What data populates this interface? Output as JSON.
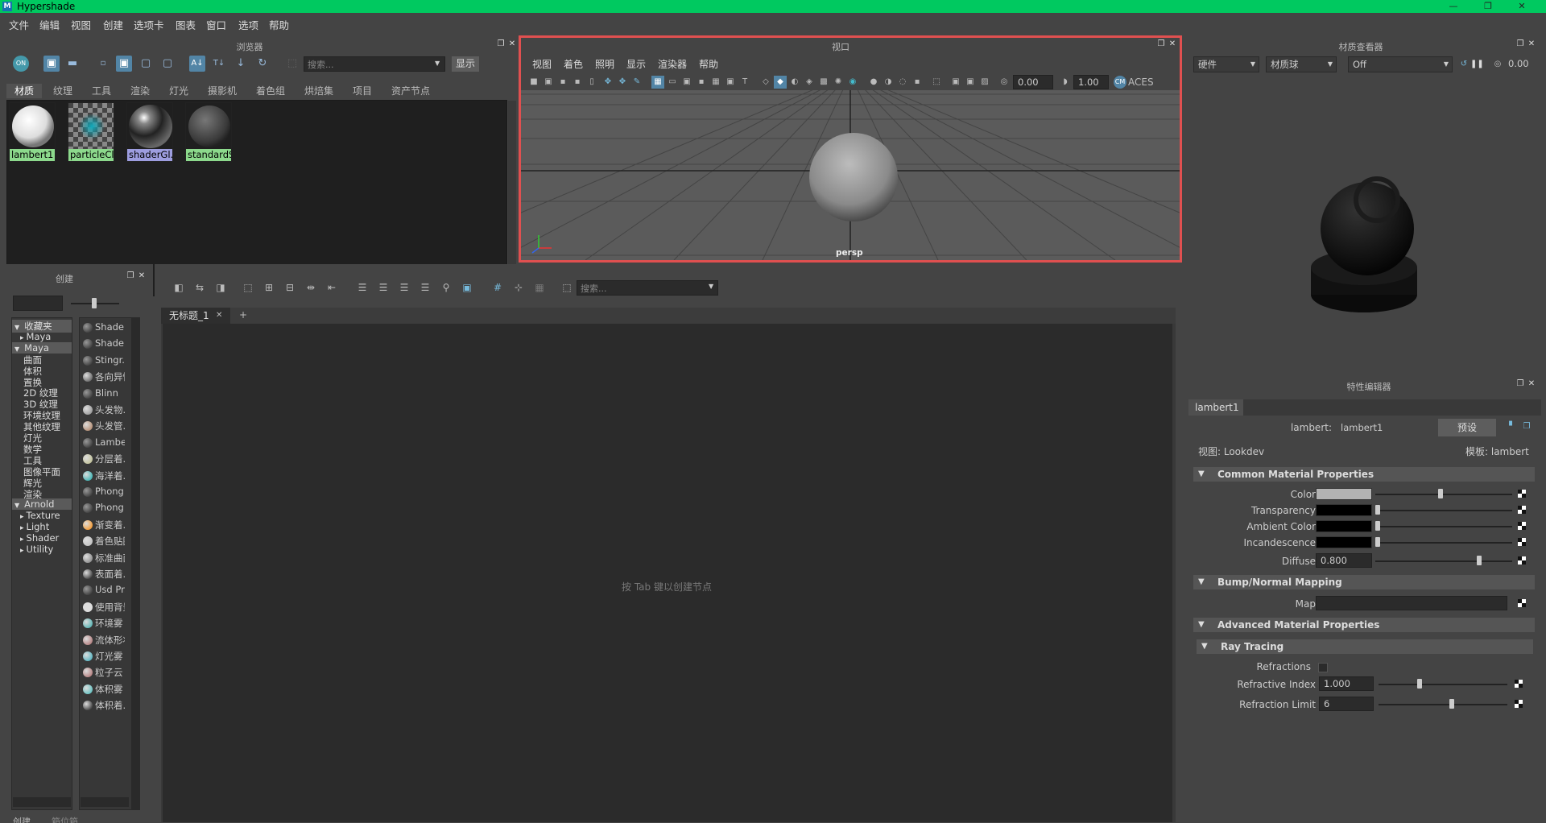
{
  "window": {
    "title": "Hypershade",
    "minimize": "—",
    "restore": "❐",
    "close": "✕"
  },
  "menus": [
    "文件",
    "编辑",
    "视图",
    "创建",
    "选项卡",
    "图表",
    "窗口",
    "选项",
    "帮助"
  ],
  "browser": {
    "title": "浏览器",
    "search_placeholder": "搜索...",
    "show_button": "显示",
    "tabs": [
      "材质",
      "纹理",
      "工具",
      "渲染",
      "灯光",
      "摄影机",
      "着色组",
      "烘焙集",
      "项目",
      "资产节点"
    ],
    "swatches": [
      {
        "label": "lambert1",
        "style": "lambert"
      },
      {
        "label": "particleCl...",
        "style": "particle"
      },
      {
        "label": "shaderGl...",
        "style": "shaderglow",
        "selected": true
      },
      {
        "label": "standardS...",
        "style": "standard"
      }
    ]
  },
  "viewport": {
    "title": "视口",
    "menus": [
      "视图",
      "着色",
      "照明",
      "显示",
      "渲染器",
      "帮助"
    ],
    "field_a": "0.00",
    "field_b": "1.00",
    "colorspace": "ACES",
    "camera_label": "persp"
  },
  "material_viewer": {
    "title": "材质查看器",
    "renderer": "硬件",
    "shape": "材质球",
    "mode": "Off",
    "value": "0.00"
  },
  "create": {
    "title": "创建",
    "tree": [
      {
        "label": "收藏夹",
        "kind": "header-open"
      },
      {
        "label": "Maya",
        "kind": "child-collapsed"
      },
      {
        "label": "Maya",
        "kind": "header-open"
      },
      {
        "label": "曲面",
        "kind": "leaf"
      },
      {
        "label": "体积",
        "kind": "leaf"
      },
      {
        "label": "置换",
        "kind": "leaf"
      },
      {
        "label": "2D 纹理",
        "kind": "leaf"
      },
      {
        "label": "3D 纹理",
        "kind": "leaf"
      },
      {
        "label": "环境纹理",
        "kind": "leaf"
      },
      {
        "label": "其他纹理",
        "kind": "leaf"
      },
      {
        "label": "灯光",
        "kind": "leaf"
      },
      {
        "label": "数学",
        "kind": "leaf"
      },
      {
        "label": "工具",
        "kind": "leaf"
      },
      {
        "label": "图像平面",
        "kind": "leaf"
      },
      {
        "label": "辉光",
        "kind": "leaf"
      },
      {
        "label": "渲染",
        "kind": "leaf"
      },
      {
        "label": "Arnold",
        "kind": "header-open"
      },
      {
        "label": "Texture",
        "kind": "child-collapsed"
      },
      {
        "label": "Light",
        "kind": "child-collapsed"
      },
      {
        "label": "Shader",
        "kind": "child-collapsed"
      },
      {
        "label": "Utility",
        "kind": "child-collapsed"
      }
    ],
    "nodes": [
      "Shade...",
      "Shade...",
      "Stingr...",
      "各向异性",
      "Blinn",
      "头发物...",
      "头发管...",
      "Lambe...",
      "分层着...",
      "海洋着...",
      "Phong",
      "Phong",
      "渐变着...",
      "着色贴图",
      "标准曲面",
      "表面着...",
      "Usd Pr...",
      "使用背景",
      "环境雾",
      "流体形状",
      "灯光雾",
      "粒子云",
      "体积雾",
      "体积着..."
    ],
    "bottom_tabs": [
      "创建",
      "箱位箱"
    ]
  },
  "graph": {
    "tab_label": "无标题_1",
    "tab_close": "✕",
    "add_tab": "+",
    "search_placeholder": "搜索...",
    "hint": "按 Tab 键以创建节点"
  },
  "attr_editor": {
    "title": "特性编辑器",
    "node_tab": "lambert1",
    "type_label": "lambert:",
    "node_name": "lambert1",
    "preset_button": "预设",
    "view_label": "视图: Lookdev",
    "template_label": "模板: lambert",
    "sections": {
      "common": "Common Material Properties",
      "bump": "Bump/Normal Mapping",
      "advanced": "Advanced Material Properties",
      "raytracing": "Ray Tracing"
    },
    "color_label": "Color",
    "transparency_label": "Transparency",
    "ambient_label": "Ambient Color",
    "incandescence_label": "Incandescence",
    "diffuse_label": "Diffuse",
    "diffuse_value": "0.800",
    "map_label": "Map",
    "refractions_label": "Refractions",
    "refractive_index_label": "Refractive Index",
    "refractive_index_value": "1.000",
    "refraction_limit_label": "Refraction Limit",
    "refraction_limit_value": "6",
    "colors": {
      "color": "#b3b3b3",
      "transparency": "#000000",
      "ambient": "#000000",
      "incandescence": "#000000"
    }
  }
}
